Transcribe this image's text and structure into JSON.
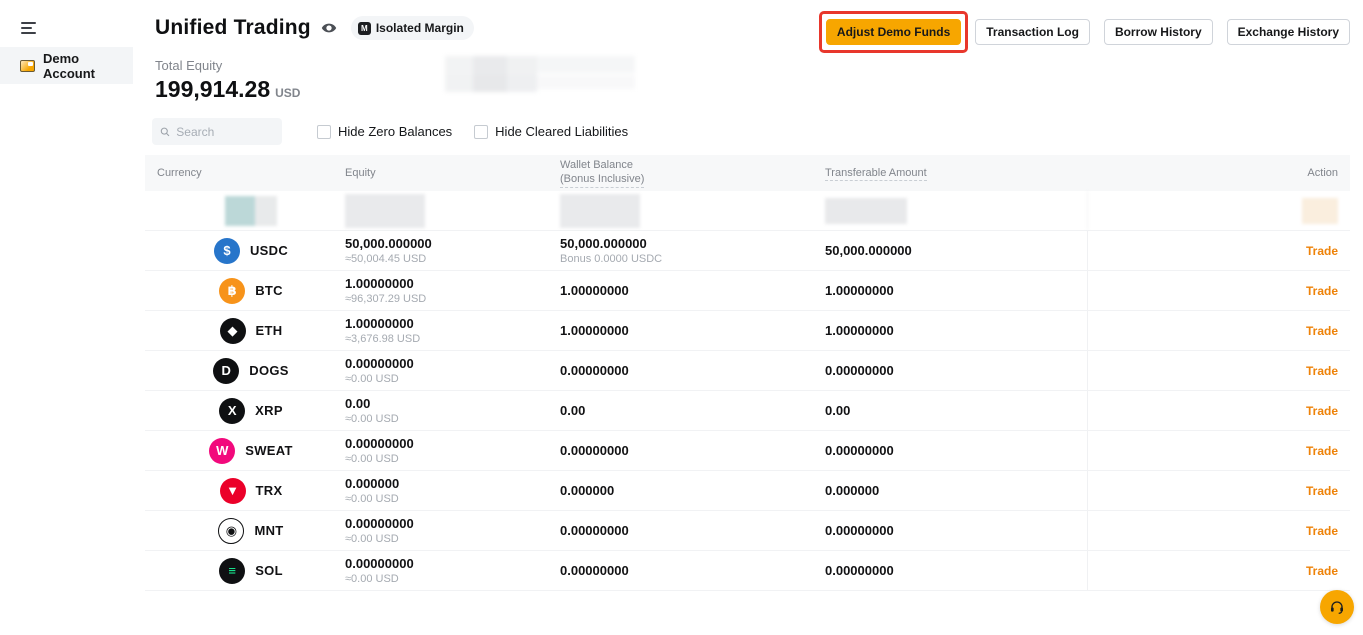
{
  "colors": {
    "brand_orange": "#f7a600",
    "trade_link_orange": "#ee8208",
    "annotation_red": "#e8372c",
    "usdc_blue": "#2775ca",
    "btc_orange": "#f7931a",
    "sweat_pink": "#f2097c",
    "trx_red": "#eb0029",
    "sol_green": "#19fb9b"
  },
  "icons": {
    "menu": "hamburger",
    "visibility": "eye",
    "margin_mode": "m-badge",
    "search": "magnifier",
    "support": "headset"
  },
  "sidebar": {
    "items": [
      {
        "label": "Demo Account"
      }
    ]
  },
  "header": {
    "title": "Unified Trading",
    "margin_badge": "Isolated Margin",
    "total_equity_label": "Total Equity",
    "total_equity_value": "199,914.28",
    "total_equity_currency": "USD",
    "buttons": {
      "adjust": "Adjust Demo Funds",
      "transaction_log": "Transaction Log",
      "borrow_history": "Borrow History",
      "exchange_history": "Exchange History"
    }
  },
  "controls": {
    "search_placeholder": "Search",
    "hide_zero_label": "Hide Zero Balances",
    "hide_cleared_label": "Hide Cleared Liabilities"
  },
  "table": {
    "columns": {
      "currency": "Currency",
      "equity": "Equity",
      "wallet_l1": "Wallet Balance",
      "wallet_l2": "(Bonus Inclusive)",
      "transferable": "Transferable Amount",
      "action": "Action"
    },
    "rows": [
      {
        "symbol": "USDC",
        "icon_glyph": "$",
        "icon_style": "background:#2775ca;color:#ffffff",
        "equity": "50,000.000000",
        "equity_usd": "≈50,004.45 USD",
        "wallet": "50,000.000000",
        "wallet_sub": "Bonus 0.0000 USDC",
        "transferable": "50,000.000000",
        "action": "Trade"
      },
      {
        "symbol": "BTC",
        "icon_glyph": "฿",
        "icon_style": "background:#f7931a;color:#ffffff",
        "equity": "1.00000000",
        "equity_usd": "≈96,307.29 USD",
        "wallet": "1.00000000",
        "transferable": "1.00000000",
        "action": "Trade"
      },
      {
        "symbol": "ETH",
        "icon_glyph": "◆",
        "icon_style": "background:#0f1012;color:#ffffff",
        "equity": "1.00000000",
        "equity_usd": "≈3,676.98 USD",
        "wallet": "1.00000000",
        "transferable": "1.00000000",
        "action": "Trade"
      },
      {
        "symbol": "DOGS",
        "icon_glyph": "D",
        "icon_style": "background:#0f1012;color:#ffffff",
        "equity": "0.00000000",
        "equity_usd": "≈0.00 USD",
        "wallet": "0.00000000",
        "transferable": "0.00000000",
        "action": "Trade"
      },
      {
        "symbol": "XRP",
        "icon_glyph": "X",
        "icon_style": "background:#0f1012;color:#ffffff",
        "equity": "0.00",
        "equity_usd": "≈0.00 USD",
        "wallet": "0.00",
        "transferable": "0.00",
        "action": "Trade"
      },
      {
        "symbol": "SWEAT",
        "icon_glyph": "W",
        "icon_style": "background:#f2097c;color:#ffffff",
        "equity": "0.00000000",
        "equity_usd": "≈0.00 USD",
        "wallet": "0.00000000",
        "transferable": "0.00000000",
        "action": "Trade"
      },
      {
        "symbol": "TRX",
        "icon_glyph": "▼",
        "icon_style": "background:#eb0029;color:#ffffff",
        "equity": "0.000000",
        "equity_usd": "≈0.00 USD",
        "wallet": "0.000000",
        "transferable": "0.000000",
        "action": "Trade"
      },
      {
        "symbol": "MNT",
        "icon_glyph": "◉",
        "icon_style": "background:#ffffff;color:#0f1012;border:1.5px solid #0f1012",
        "equity": "0.00000000",
        "equity_usd": "≈0.00 USD",
        "wallet": "0.00000000",
        "transferable": "0.00000000",
        "action": "Trade"
      },
      {
        "symbol": "SOL",
        "icon_glyph": "≡",
        "icon_style": "background:#0f1012;color:#19fb9b",
        "equity": "0.00000000",
        "equity_usd": "≈0.00 USD",
        "wallet": "0.00000000",
        "transferable": "0.00000000",
        "action": "Trade"
      }
    ]
  }
}
